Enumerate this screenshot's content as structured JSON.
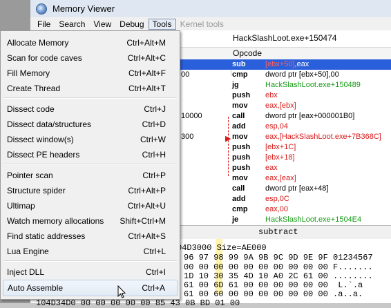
{
  "window": {
    "title": "Memory Viewer"
  },
  "menubar": [
    {
      "label": "File"
    },
    {
      "label": "Search"
    },
    {
      "label": "View"
    },
    {
      "label": "Debug"
    },
    {
      "label": "Tools"
    },
    {
      "label": "Kernel tools"
    }
  ],
  "disasm": {
    "address_header": "HackSlashLoot.exe+150474",
    "opcode_header": "Opcode",
    "rows": [
      {
        "pfx": "",
        "mn": "sub",
        "args": [
          "[ebx+50]",
          ",eax"
        ],
        "sel": true
      },
      {
        "pfx": "00",
        "mn": "cmp",
        "args": [
          "dword ptr [ebx+50],00"
        ]
      },
      {
        "pfx": "",
        "mn": "jg",
        "args": [
          "HackSlashLoot.exe+150489"
        ]
      },
      {
        "pfx": "",
        "mn": "push",
        "args": [
          "ebx"
        ]
      },
      {
        "pfx": "",
        "mn": "mov",
        "args": [
          "eax,[ebx]"
        ]
      },
      {
        "pfx": "10000",
        "mn": "call",
        "args": [
          "dword ptr [eax+000001B0]"
        ]
      },
      {
        "pfx": "",
        "mn": "add",
        "args": [
          "esp,04"
        ]
      },
      {
        "pfx": "300",
        "mn": "mov",
        "args": [
          "eax,[HackSlashLoot.exe+7B368C]"
        ]
      },
      {
        "pfx": "",
        "mn": "push",
        "args": [
          "[ebx+1C]"
        ]
      },
      {
        "pfx": "",
        "mn": "push",
        "args": [
          "[ebx+18]"
        ]
      },
      {
        "pfx": "",
        "mn": "push",
        "args": [
          "eax"
        ]
      },
      {
        "pfx": "",
        "mn": "mov",
        "args": [
          "eax,[eax]"
        ]
      },
      {
        "pfx": "",
        "mn": "call",
        "args": [
          "dword ptr [eax+48]"
        ]
      },
      {
        "pfx": "",
        "mn": "add",
        "args": [
          "esp,0C"
        ]
      },
      {
        "pfx": "",
        "mn": "cmp",
        "args": [
          "eax,00"
        ]
      },
      {
        "pfx": "",
        "mn": "je",
        "args": [
          "HackSlashLoot.exe+1504E4"
        ]
      }
    ],
    "status": "subtract"
  },
  "hex": {
    "lines": [
      "04D3000 Size=AE000",
      "96 97 98 99 9A 9B 9C 9D 9E 9F 01234567",
      "00 00 00 00 00 00 00 00 00 00 F.......",
      "1D 10 30 35 4D 10 A0 2C 61 00 ........",
      "61 00 6D 61 00 00 00 00 00 00  L.`.a",
      "61 00 60 00 00 00 00 00 00 00 .a..a.",
      "104D34D0 00 00 00 00 00 85 43 0B BD 01 00"
    ]
  },
  "tools_menu": {
    "items": [
      {
        "label": "Allocate Memory",
        "shortcut": "Ctrl+Alt+M"
      },
      {
        "label": "Scan for code caves",
        "shortcut": "Ctrl+Alt+C"
      },
      {
        "label": "Fill Memory",
        "shortcut": "Ctrl+Alt+F"
      },
      {
        "label": "Create Thread",
        "shortcut": "Ctrl+Alt+T"
      },
      {
        "label": "Dissect code",
        "shortcut": "Ctrl+J"
      },
      {
        "label": "Dissect data/structures",
        "shortcut": "Ctrl+D"
      },
      {
        "label": "Dissect window(s)",
        "shortcut": "Ctrl+W"
      },
      {
        "label": "Dissect PE headers",
        "shortcut": "Ctrl+H"
      },
      {
        "label": "Pointer scan",
        "shortcut": "Ctrl+P"
      },
      {
        "label": "Structure spider",
        "shortcut": "Ctrl+Alt+P"
      },
      {
        "label": "Ultimap",
        "shortcut": "Ctrl+Alt+U"
      },
      {
        "label": "Watch memory allocations",
        "shortcut": "Shift+Ctrl+M"
      },
      {
        "label": "Find static addresses",
        "shortcut": "Ctrl+Alt+S"
      },
      {
        "label": "Lua Engine",
        "shortcut": "Ctrl+L"
      },
      {
        "label": "Inject DLL",
        "shortcut": "Ctrl+I"
      },
      {
        "label": "Auto Assemble",
        "shortcut": "Ctrl+A"
      }
    ]
  },
  "colors": {
    "selection": "#2a5fdb",
    "register": "#d81818",
    "symbol": "#159a15"
  }
}
